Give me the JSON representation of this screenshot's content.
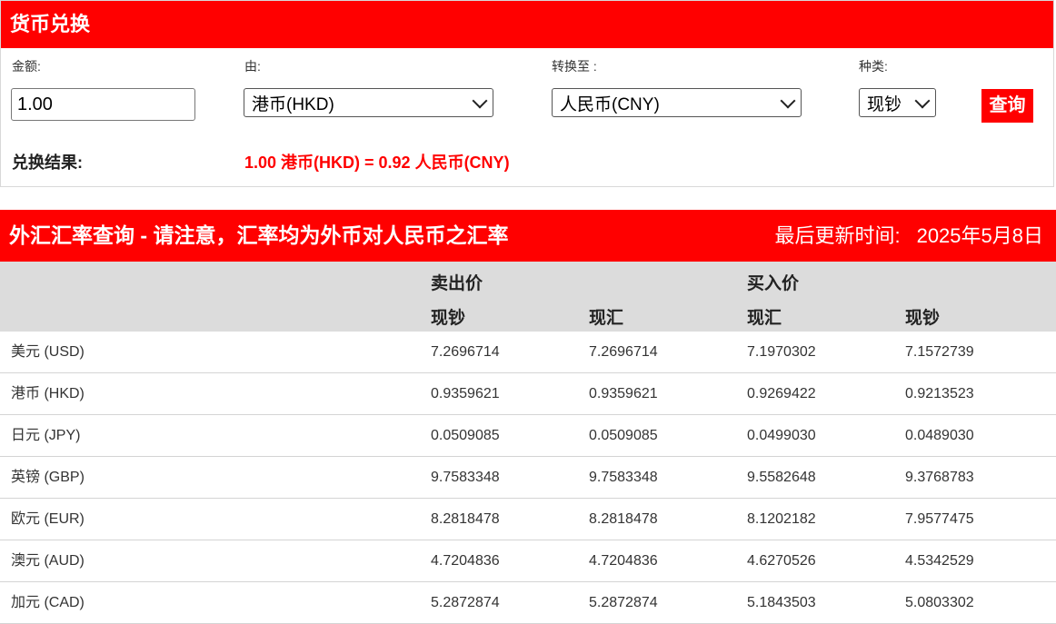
{
  "converter": {
    "title": "货币兑换",
    "amount_label": "金额:",
    "from_label": "由:",
    "to_label": "转换至 :",
    "type_label": "种类:",
    "amount_value": "1.00",
    "from_value": "港币(HKD)",
    "to_value": "人民币(CNY)",
    "type_value": "现钞",
    "query_button": "查询",
    "result_label": "兑换结果:",
    "result_value": "1.00 港币(HKD) = 0.92 人民币(CNY)"
  },
  "rates": {
    "title": "外汇汇率查询 - 请注意，汇率均为外币对人民币之汇率",
    "updated_label": "最后更新时间:",
    "updated_value": "2025年5月8日",
    "group_sell": "卖出价",
    "group_buy": "买入价",
    "columns": [
      "现钞",
      "现汇",
      "现汇",
      "现钞"
    ],
    "rows": [
      {
        "currency": "美元 (USD)",
        "sell_cash": "7.2696714",
        "sell_transfer": "7.2696714",
        "buy_transfer": "7.1970302",
        "buy_cash": "7.1572739"
      },
      {
        "currency": "港币 (HKD)",
        "sell_cash": "0.9359621",
        "sell_transfer": "0.9359621",
        "buy_transfer": "0.9269422",
        "buy_cash": "0.9213523"
      },
      {
        "currency": "日元 (JPY)",
        "sell_cash": "0.0509085",
        "sell_transfer": "0.0509085",
        "buy_transfer": "0.0499030",
        "buy_cash": "0.0489030"
      },
      {
        "currency": "英镑 (GBP)",
        "sell_cash": "9.7583348",
        "sell_transfer": "9.7583348",
        "buy_transfer": "9.5582648",
        "buy_cash": "9.3768783"
      },
      {
        "currency": "欧元 (EUR)",
        "sell_cash": "8.2818478",
        "sell_transfer": "8.2818478",
        "buy_transfer": "8.1202182",
        "buy_cash": "7.9577475"
      },
      {
        "currency": "澳元 (AUD)",
        "sell_cash": "4.7204836",
        "sell_transfer": "4.7204836",
        "buy_transfer": "4.6270526",
        "buy_cash": "4.5342529"
      },
      {
        "currency": "加元 (CAD)",
        "sell_cash": "5.2872874",
        "sell_transfer": "5.2872874",
        "buy_transfer": "5.1843503",
        "buy_cash": "5.0803302"
      }
    ]
  },
  "colors": {
    "accent": "#ff0000",
    "table_header_bg": "#dcdcdc"
  },
  "icons": {
    "select_arrow": "chevron-down-icon"
  }
}
